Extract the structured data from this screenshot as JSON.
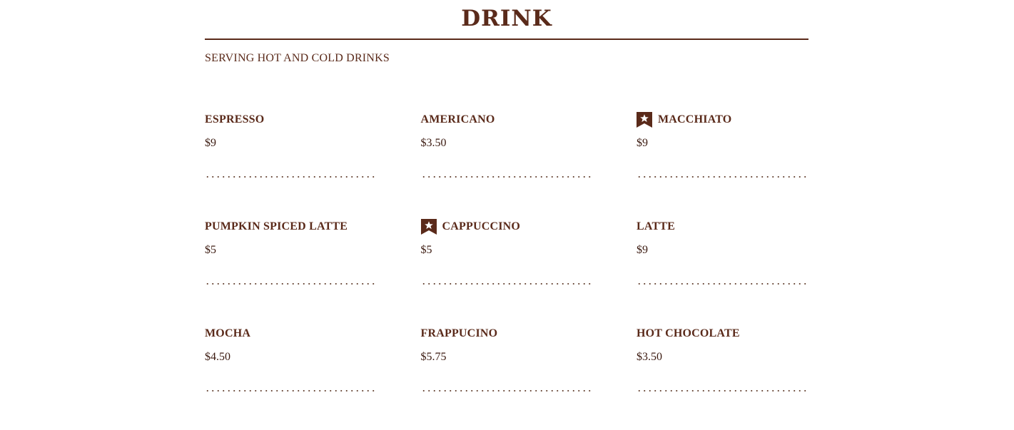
{
  "section": {
    "title": "DRINK",
    "subtitle": "SERVING HOT AND COLD DRINKS"
  },
  "colors": {
    "brand_brown": "#5a2a1a",
    "price_text": "#3b1a10"
  },
  "items": [
    {
      "name": "ESPRESSO",
      "price": "$9",
      "featured": false
    },
    {
      "name": "AMERICANO",
      "price": "$3.50",
      "featured": false
    },
    {
      "name": "MACCHIATO",
      "price": "$9",
      "featured": true,
      "icon": "star-bookmark-icon"
    },
    {
      "name": "PUMPKIN SPICED LATTE",
      "price": "$5",
      "featured": false
    },
    {
      "name": "CAPPUCCINO",
      "price": "$5",
      "featured": true,
      "icon": "star-bookmark-icon"
    },
    {
      "name": "LATTE",
      "price": "$9",
      "featured": false
    },
    {
      "name": "MOCHA",
      "price": "$4.50",
      "featured": false
    },
    {
      "name": "FRAPPUCINO",
      "price": "$5.75",
      "featured": false
    },
    {
      "name": "HOT CHOCOLATE",
      "price": "$3.50",
      "featured": false
    }
  ]
}
